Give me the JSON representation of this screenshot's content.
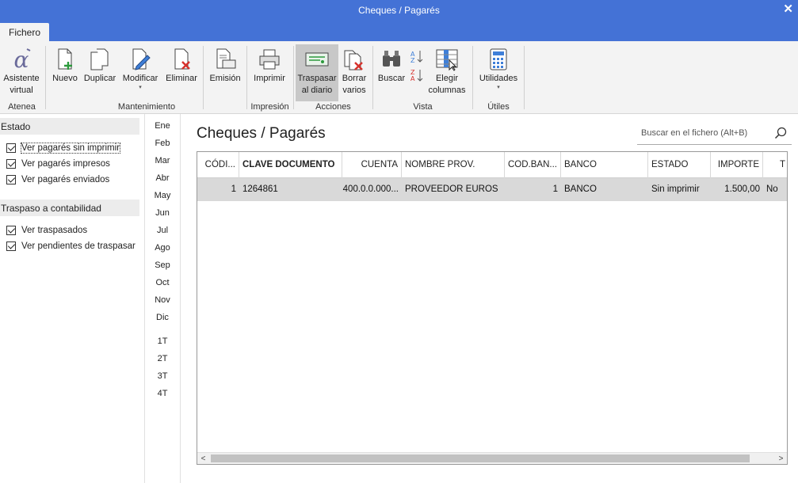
{
  "window": {
    "title": "Cheques / Pagarés",
    "close": "✕"
  },
  "tabs": {
    "file": "Fichero"
  },
  "ribbon": {
    "buttons": {
      "asistente_l1": "Asistente",
      "asistente_l2": "virtual",
      "nuevo": "Nuevo",
      "duplicar": "Duplicar",
      "modificar": "Modificar",
      "eliminar": "Eliminar",
      "emision": "Emisión",
      "imprimir": "Imprimir",
      "traspasar_l1": "Traspasar",
      "traspasar_l2": "al diario",
      "borrar_l1": "Borrar",
      "borrar_l2": "varios",
      "buscar": "Buscar",
      "elegir_l1": "Elegir",
      "elegir_l2": "columnas",
      "utilidades": "Utilidades",
      "caret": "▾"
    },
    "groups": {
      "atenea": "Atenea",
      "mantenimiento": "Mantenimiento",
      "impresion": "Impresión",
      "acciones": "Acciones",
      "vista": "Vista",
      "utiles": "Útiles"
    }
  },
  "sidebar": {
    "estado": {
      "title": "Estado",
      "items": [
        "Ver pagarés sin imprimir",
        "Ver pagarés impresos",
        "Ver pagarés enviados"
      ]
    },
    "traspaso": {
      "title": "Traspaso a contabilidad",
      "items": [
        "Ver traspasados",
        "Ver pendientes de traspasar"
      ]
    }
  },
  "months": [
    "Ene",
    "Feb",
    "Mar",
    "Abr",
    "May",
    "Jun",
    "Jul",
    "Ago",
    "Sep",
    "Oct",
    "Nov",
    "Dic"
  ],
  "quarters": [
    "1T",
    "2T",
    "3T",
    "4T"
  ],
  "main": {
    "title": "Cheques / Pagarés",
    "search_placeholder": "Buscar en el fichero (Alt+B)"
  },
  "table": {
    "headers": [
      "CÓDI...",
      "CLAVE DOCUMENTO",
      "CUENTA",
      "NOMBRE PROV.",
      "COD.BAN...",
      "BANCO",
      "ESTADO",
      "IMPORTE",
      "T"
    ],
    "rows": [
      [
        "1",
        "1264861",
        "400.0.0.000...",
        "PROVEEDOR EUROS",
        "1",
        "BANCO",
        "Sin imprimir",
        "1.500,00",
        "No"
      ]
    ],
    "scroll_left": "<",
    "scroll_right": ">"
  }
}
